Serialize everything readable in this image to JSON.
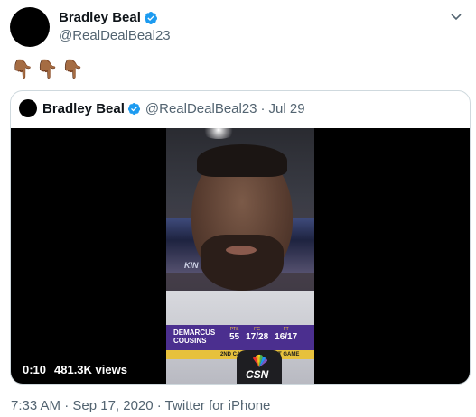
{
  "tweet": {
    "author_name": "Bradley Beal",
    "author_handle": "@RealDealBeal23",
    "text": "👇🏾👇🏾👇🏾",
    "footer": "7:33 AM · Sep 17, 2020 · Twitter for iPhone"
  },
  "quoted": {
    "author_name": "Bradley Beal",
    "author_handle": "@RealDealBeal23",
    "separator": "·",
    "date": "Jul 29",
    "video": {
      "arena_text": "KIN",
      "lower_third": {
        "player_first": "DEMARCUS",
        "player_last": "COUSINS",
        "stat_labels": [
          "PTS",
          "FG",
          "FT"
        ],
        "stat_values": [
          "55",
          "17/28",
          "16/17"
        ],
        "note": "2ND CAREER 50-POINT GAME"
      },
      "mic_flag": "CSN",
      "elapsed": "0:10",
      "views": "481.3K views"
    }
  },
  "colors": {
    "verified": "#1d9bf0",
    "secondary_text": "#536471",
    "border": "#cfd9de"
  },
  "icons": [
    "verified-badge-icon",
    "more-chevron-icon",
    "nbc-peacock-icon"
  ]
}
